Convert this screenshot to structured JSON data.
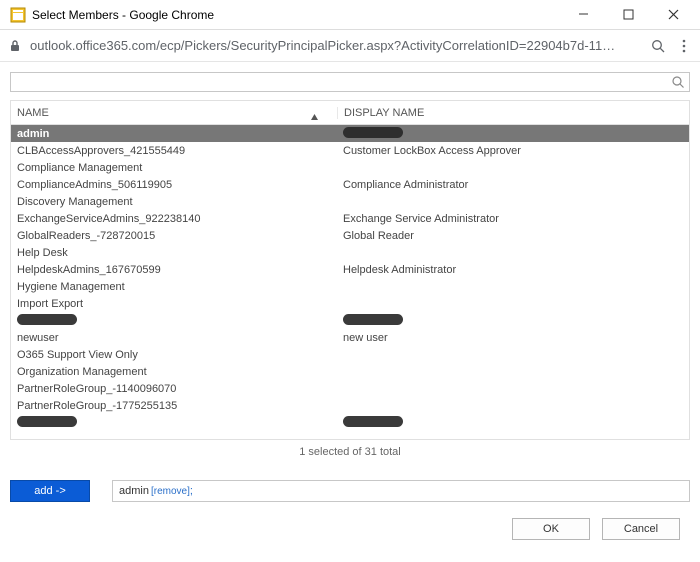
{
  "window": {
    "title": "Select Members - Google Chrome",
    "url": "outlook.office365.com/ecp/Pickers/SecurityPrincipalPicker.aspx?ActivityCorrelationID=22904b7d-11…"
  },
  "search": {
    "placeholder": ""
  },
  "columns": {
    "name": "NAME",
    "display": "DISPLAY NAME"
  },
  "rows": [
    {
      "name": "admin",
      "display": "[redacted]",
      "selected": true
    },
    {
      "name": "CLBAccessApprovers_421555449",
      "display": "Customer LockBox Access Approver"
    },
    {
      "name": "Compliance Management",
      "display": ""
    },
    {
      "name": "ComplianceAdmins_506119905",
      "display": "Compliance Administrator"
    },
    {
      "name": "Discovery Management",
      "display": ""
    },
    {
      "name": "ExchangeServiceAdmins_922238140",
      "display": "Exchange Service Administrator"
    },
    {
      "name": "GlobalReaders_-728720015",
      "display": "Global Reader"
    },
    {
      "name": "Help Desk",
      "display": ""
    },
    {
      "name": "HelpdeskAdmins_167670599",
      "display": "Helpdesk Administrator"
    },
    {
      "name": "Hygiene Management",
      "display": ""
    },
    {
      "name": "Import Export",
      "display": ""
    },
    {
      "name": "[redacted]",
      "display": "[redacted]"
    },
    {
      "name": "newuser",
      "display": "new user"
    },
    {
      "name": "O365 Support View Only",
      "display": ""
    },
    {
      "name": "Organization Management",
      "display": ""
    },
    {
      "name": "PartnerRoleGroup_-1140096070",
      "display": ""
    },
    {
      "name": "PartnerRoleGroup_-1775255135",
      "display": ""
    },
    {
      "name": "[redacted]",
      "display": "[redacted]"
    }
  ],
  "status": "1 selected of 31 total",
  "add": {
    "button": "add ->",
    "member": "admin",
    "remove": "[remove]"
  },
  "buttons": {
    "ok": "OK",
    "cancel": "Cancel"
  }
}
